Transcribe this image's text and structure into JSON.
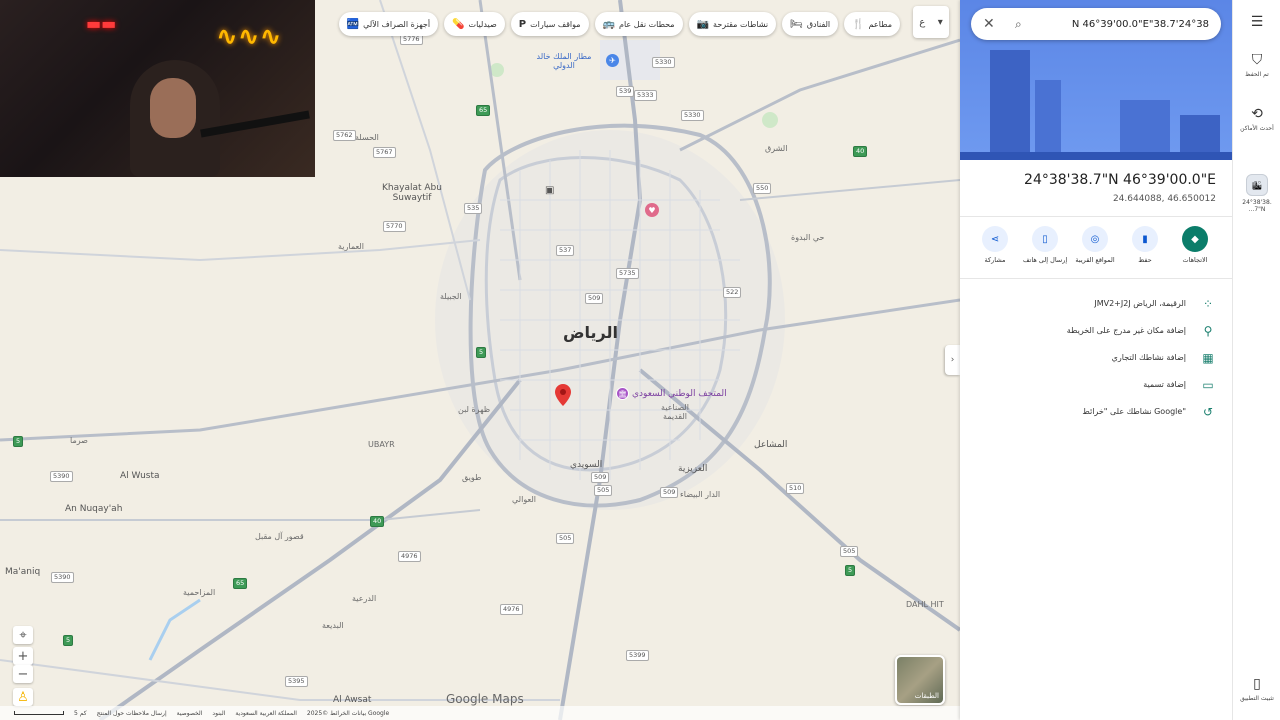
{
  "search": {
    "query": "N 46°39'00.0\"E\"38.7'24°38"
  },
  "place": {
    "title": "24°38'38.7\"N 46°39'00.0\"E",
    "decimal": "24.644088, 46.650012"
  },
  "actions": [
    {
      "label": "الاتجاهات",
      "icon": "directions-icon"
    },
    {
      "label": "حفظ",
      "icon": "bookmark-icon"
    },
    {
      "label": "المواقع القريبة",
      "icon": "nearby-icon"
    },
    {
      "label": "إرسال إلى هاتف",
      "icon": "phone-icon"
    },
    {
      "label": "مشاركة",
      "icon": "share-icon"
    }
  ],
  "info_rows": [
    {
      "text": "JMV2+J2J الرقيمة، الرياض",
      "icon": "pluscode-icon"
    },
    {
      "text": "إضافة مكان غير مدرج على الخريطة",
      "icon": "add-place-icon"
    },
    {
      "text": "إضافة نشاطك التجاري",
      "icon": "add-business-icon"
    },
    {
      "text": "إضافة تسمية",
      "icon": "label-icon"
    },
    {
      "text": "نشاطك على \"خرائط Google\"",
      "icon": "history-icon"
    }
  ],
  "rail": {
    "saved": "تم الحفظ",
    "recent": "أحدث الأماكن",
    "recent_item": "24°38'38.\n...7\"N",
    "install": "تثبيت التطبيق"
  },
  "chips": [
    {
      "label": "مطاعم",
      "icon": "🍴"
    },
    {
      "label": "الفنادق",
      "icon": "🛏"
    },
    {
      "label": "نشاطات مقترحة",
      "icon": "📷"
    },
    {
      "label": "محطات نقل عام",
      "icon": "🚌"
    },
    {
      "label": "مواقف سيارات",
      "icon": "P"
    },
    {
      "label": "صيدليات",
      "icon": "💊"
    },
    {
      "label": "أجهزة الصراف الآلي",
      "icon": "🏧"
    }
  ],
  "more_chip": "ع",
  "map": {
    "city": "الرياض",
    "museum": "المتحف الوطني السعودي",
    "airport": "مطار الملك خالد الدولي",
    "logo": "Google Maps",
    "layers_label": "الطبقات",
    "places": [
      {
        "t": "Khayalat Abu Suwaytif",
        "c": "mid"
      },
      {
        "t": "العمارية",
        "c": ""
      },
      {
        "t": "الجبيلة",
        "c": ""
      },
      {
        "t": "Al Wusta",
        "c": "mid"
      },
      {
        "t": "An Nuqay'ah",
        "c": "mid"
      },
      {
        "t": "Ma'aniq",
        "c": "mid"
      },
      {
        "t": "UBAYR",
        "c": ""
      },
      {
        "t": "DAHL HIT",
        "c": ""
      },
      {
        "t": "Al Awsat",
        "c": "mid"
      },
      {
        "t": "الدرعية",
        "c": ""
      },
      {
        "t": "المشاعل",
        "c": "mid"
      },
      {
        "t": "السويدي",
        "c": "mid"
      },
      {
        "t": "العزيزية",
        "c": "mid"
      },
      {
        "t": "الدار البيضاء",
        "c": ""
      },
      {
        "t": "طويق",
        "c": ""
      },
      {
        "t": "العوالي",
        "c": ""
      },
      {
        "t": "ظهرة لبن",
        "c": ""
      },
      {
        "t": "الشرق",
        "c": ""
      },
      {
        "t": "البديعة",
        "c": ""
      },
      {
        "t": "المزاحمية",
        "c": ""
      },
      {
        "t": "حي البدوة",
        "c": ""
      },
      {
        "t": "قصور آل مقبل",
        "c": ""
      },
      {
        "t": "الصناعية القديمة",
        "c": ""
      },
      {
        "t": "صرما",
        "c": ""
      },
      {
        "t": "الحسلة",
        "c": ""
      }
    ],
    "shields": [
      "5776",
      "5330",
      "539",
      "5333",
      "5330",
      "535",
      "5762",
      "5767",
      "5770",
      "537",
      "5735",
      "509",
      "522",
      "550",
      "65",
      "40",
      "509",
      "5",
      "5390",
      "5",
      "4976",
      "65",
      "505",
      "40",
      "5390",
      "505",
      "5399",
      "4976",
      "510",
      "5395",
      "5",
      "505",
      "5",
      "509"
    ]
  },
  "footer": {
    "scale": "5 كم",
    "items": [
      "إرسال ملاحظات حول المنتج",
      "الخصوصية",
      "البنود",
      "المملكة العربية السعودية",
      "بيانات الخرائط ©2025 Google"
    ]
  }
}
